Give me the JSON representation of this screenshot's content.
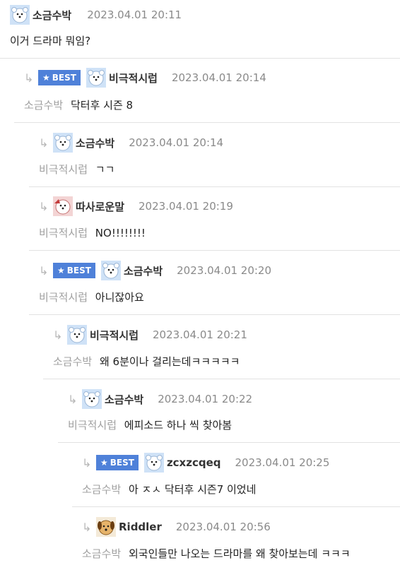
{
  "best_label": "BEST",
  "colors": {
    "best_bg": "#4f81d9",
    "mention": "#a0a0a0",
    "date": "#8a8a8a"
  },
  "comments": [
    {
      "nick": "소금수박",
      "date": "2023.04.01 20:11",
      "mention": "",
      "text": "이거 드라마 뭐임?",
      "best": false,
      "reply": false
    },
    {
      "nick": "비극적시럽",
      "date": "2023.04.01 20:14",
      "mention": "소금수박",
      "text": "닥터후 시즌 8",
      "best": true,
      "reply": true
    },
    {
      "nick": "소금수박",
      "date": "2023.04.01 20:14",
      "mention": "비극적시럽",
      "text": "ㄱㄱ",
      "best": false,
      "reply": true
    },
    {
      "nick": "따사로운말",
      "date": "2023.04.01 20:19",
      "mention": "비극적시럽",
      "text": "NO!!!!!!!!",
      "best": false,
      "reply": true
    },
    {
      "nick": "소금수박",
      "date": "2023.04.01 20:20",
      "mention": "비극적시럽",
      "text": "아니잖아요",
      "best": true,
      "reply": true
    },
    {
      "nick": "비극적시럽",
      "date": "2023.04.01 20:21",
      "mention": "소금수박",
      "text": "왜 6분이나 걸리는데ㅋㅋㅋㅋㅋ",
      "best": false,
      "reply": true
    },
    {
      "nick": "소금수박",
      "date": "2023.04.01 20:22",
      "mention": "비극적시럽",
      "text": "에피소드 하나 씩 찾아봄",
      "best": false,
      "reply": true
    },
    {
      "nick": "zcxzcqeq",
      "date": "2023.04.01 20:25",
      "mention": "소금수박",
      "text": "아 ㅈㅅ 닥터후 시즌7 이었네",
      "best": true,
      "reply": true
    },
    {
      "nick": "Riddler",
      "date": "2023.04.01 20:56",
      "mention": "소금수박",
      "text": "외국인들만 나오는 드라마를 왜 찾아보는데 ㅋㅋㅋ",
      "best": false,
      "reply": true
    }
  ]
}
